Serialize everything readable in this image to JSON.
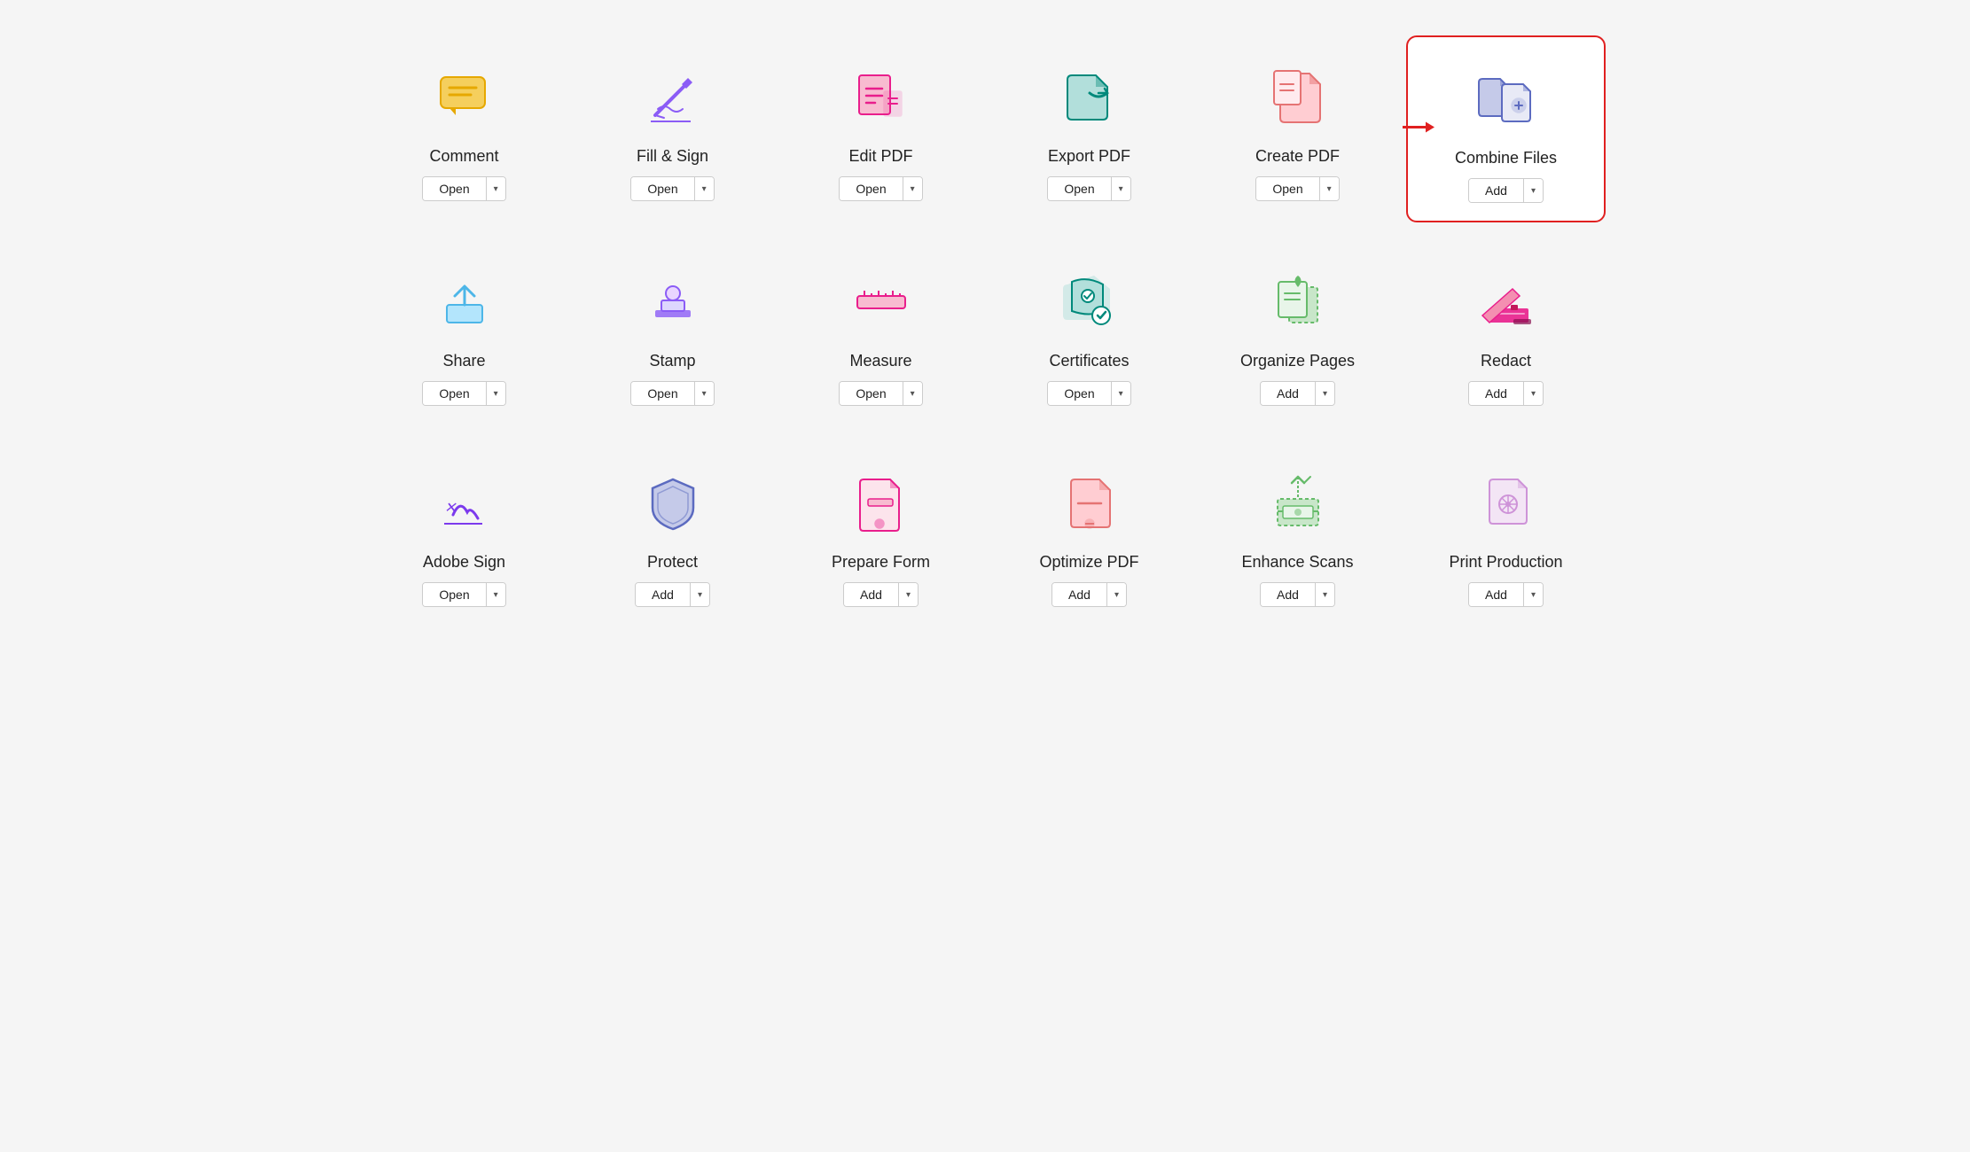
{
  "tools": [
    {
      "id": "comment",
      "label": "Comment",
      "button": "Open",
      "highlighted": false,
      "show_arrow": false,
      "icon_color": "#e6a800",
      "icon_type": "comment"
    },
    {
      "id": "fill-sign",
      "label": "Fill & Sign",
      "button": "Open",
      "highlighted": false,
      "show_arrow": false,
      "icon_color": "#8b5cf6",
      "icon_type": "fill-sign"
    },
    {
      "id": "edit-pdf",
      "label": "Edit PDF",
      "button": "Open",
      "highlighted": false,
      "show_arrow": false,
      "icon_color": "#e91e8c",
      "icon_type": "edit-pdf"
    },
    {
      "id": "export-pdf",
      "label": "Export PDF",
      "button": "Open",
      "highlighted": false,
      "show_arrow": false,
      "icon_color": "#00897b",
      "icon_type": "export-pdf"
    },
    {
      "id": "create-pdf",
      "label": "Create PDF",
      "button": "Open",
      "highlighted": false,
      "show_arrow": true,
      "icon_color": "#e57373",
      "icon_type": "create-pdf"
    },
    {
      "id": "combine-files",
      "label": "Combine Files",
      "button": "Add",
      "highlighted": true,
      "show_arrow": false,
      "icon_color": "#5c6bc0",
      "icon_type": "combine-files"
    },
    {
      "id": "share",
      "label": "Share",
      "button": "Open",
      "highlighted": false,
      "show_arrow": false,
      "icon_color": "#4db6e8",
      "icon_type": "share"
    },
    {
      "id": "stamp",
      "label": "Stamp",
      "button": "Open",
      "highlighted": false,
      "show_arrow": false,
      "icon_color": "#8b5cf6",
      "icon_type": "stamp"
    },
    {
      "id": "measure",
      "label": "Measure",
      "button": "Open",
      "highlighted": false,
      "show_arrow": false,
      "icon_color": "#e91e8c",
      "icon_type": "measure"
    },
    {
      "id": "certificates",
      "label": "Certificates",
      "button": "Open",
      "highlighted": false,
      "show_arrow": false,
      "icon_color": "#00897b",
      "icon_type": "certificates"
    },
    {
      "id": "organize-pages",
      "label": "Organize Pages",
      "button": "Add",
      "highlighted": false,
      "show_arrow": false,
      "icon_color": "#66bb6a",
      "icon_type": "organize-pages"
    },
    {
      "id": "redact",
      "label": "Redact",
      "button": "Add",
      "highlighted": false,
      "show_arrow": false,
      "icon_color": "#e91e8c",
      "icon_type": "redact"
    },
    {
      "id": "adobe-sign",
      "label": "Adobe Sign",
      "button": "Open",
      "highlighted": false,
      "show_arrow": false,
      "icon_color": "#7c3aed",
      "icon_type": "adobe-sign"
    },
    {
      "id": "protect",
      "label": "Protect",
      "button": "Add",
      "highlighted": false,
      "show_arrow": false,
      "icon_color": "#5c6bc0",
      "icon_type": "protect"
    },
    {
      "id": "prepare-form",
      "label": "Prepare Form",
      "button": "Add",
      "highlighted": false,
      "show_arrow": false,
      "icon_color": "#e91e8c",
      "icon_type": "prepare-form"
    },
    {
      "id": "optimize-pdf",
      "label": "Optimize PDF",
      "button": "Add",
      "highlighted": false,
      "show_arrow": false,
      "icon_color": "#e57373",
      "icon_type": "optimize-pdf"
    },
    {
      "id": "enhance-scans",
      "label": "Enhance Scans",
      "button": "Add",
      "highlighted": false,
      "show_arrow": false,
      "icon_color": "#66bb6a",
      "icon_type": "enhance-scans"
    },
    {
      "id": "print-production",
      "label": "Print Production",
      "button": "Add",
      "highlighted": false,
      "show_arrow": false,
      "icon_color": "#ce93d8",
      "icon_type": "print-production"
    }
  ]
}
